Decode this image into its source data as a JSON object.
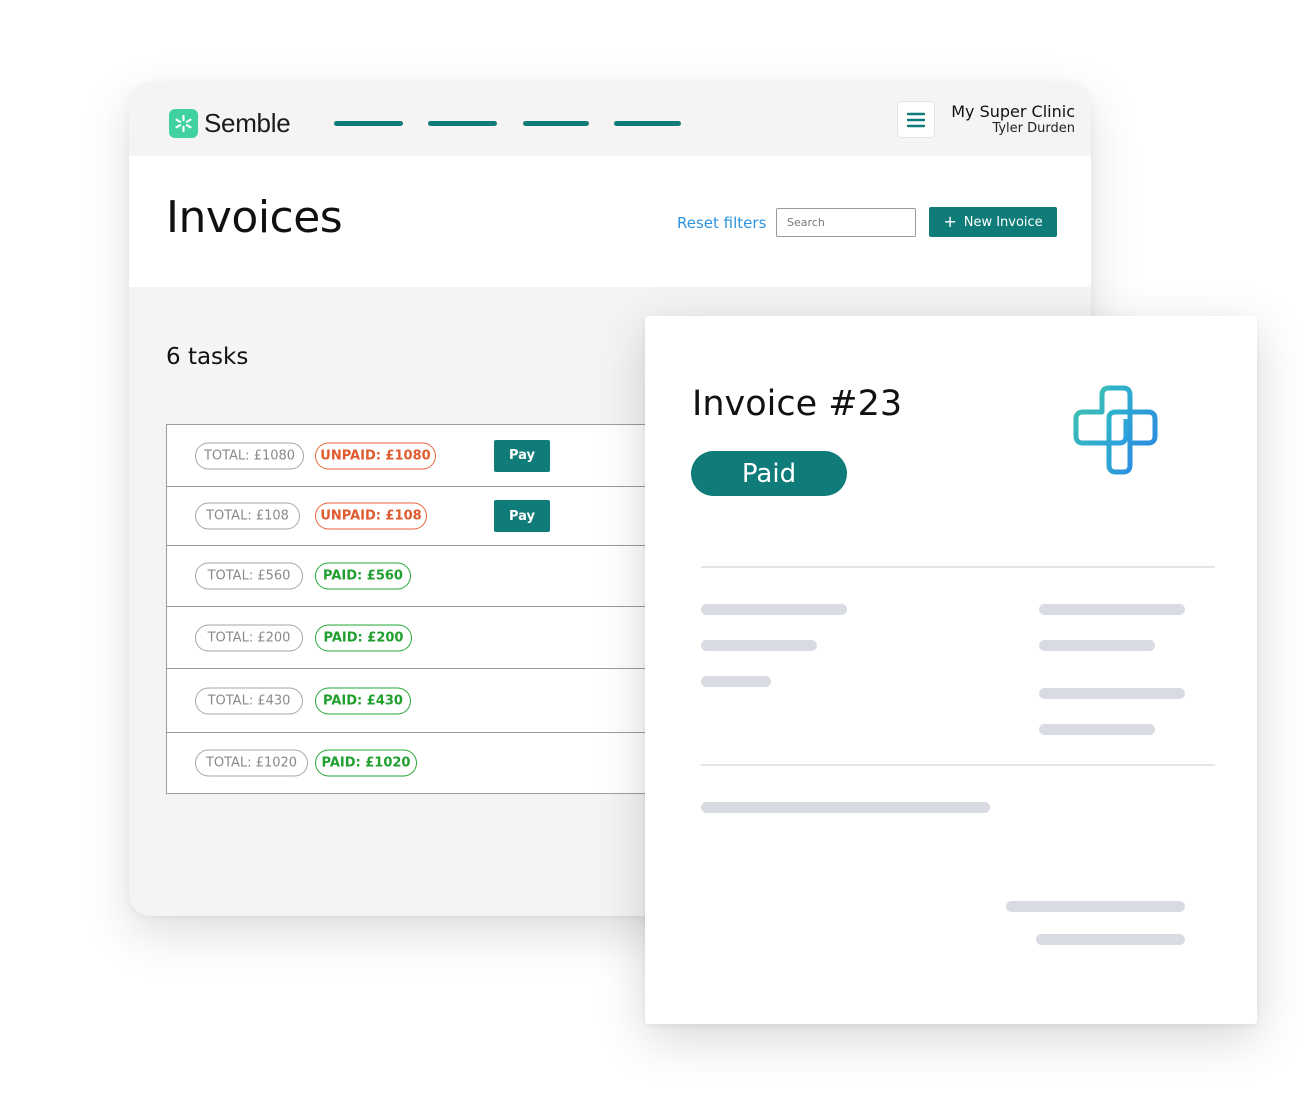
{
  "app": {
    "brand_name": "Semble",
    "brand_color": "#3fd2a0",
    "accent_color": "#107c7a",
    "logo_icon": "semble-asterisk-icon",
    "menu_icon": "hamburger-menu-icon",
    "clinic_name": "My Super Clinic",
    "user_name": "Tyler Durden"
  },
  "page": {
    "title": "Invoices",
    "reset_filters_label": "Reset filters",
    "search_placeholder": "Search",
    "new_invoice_label": "New Invoice",
    "new_invoice_icon": "plus-icon",
    "tasks_count_label": "6 tasks"
  },
  "tasks": [
    {
      "total": "TOTAL: £1080",
      "status": "UNPAID: £1080",
      "state": "unpaid",
      "action": "Pay"
    },
    {
      "total": "TOTAL: £108",
      "status": "UNPAID: £108",
      "state": "unpaid",
      "action": "Pay"
    },
    {
      "total": "TOTAL: £560",
      "status": "PAID: £560",
      "state": "paid"
    },
    {
      "total": "TOTAL: £200",
      "status": "PAID: £200",
      "state": "paid"
    },
    {
      "total": "TOTAL: £430",
      "status": "PAID: £430",
      "state": "paid"
    },
    {
      "total": "TOTAL: £1020",
      "status": "PAID: £1020",
      "state": "paid"
    }
  ],
  "status_colors": {
    "unpaid": "#e8643c",
    "paid": "#23a834"
  },
  "invoice": {
    "title": "Invoice #23",
    "status": "Paid",
    "logo_icon": "medical-cross-icon",
    "logo_colors": [
      "#3fc7a5",
      "#2b9fe0"
    ]
  }
}
